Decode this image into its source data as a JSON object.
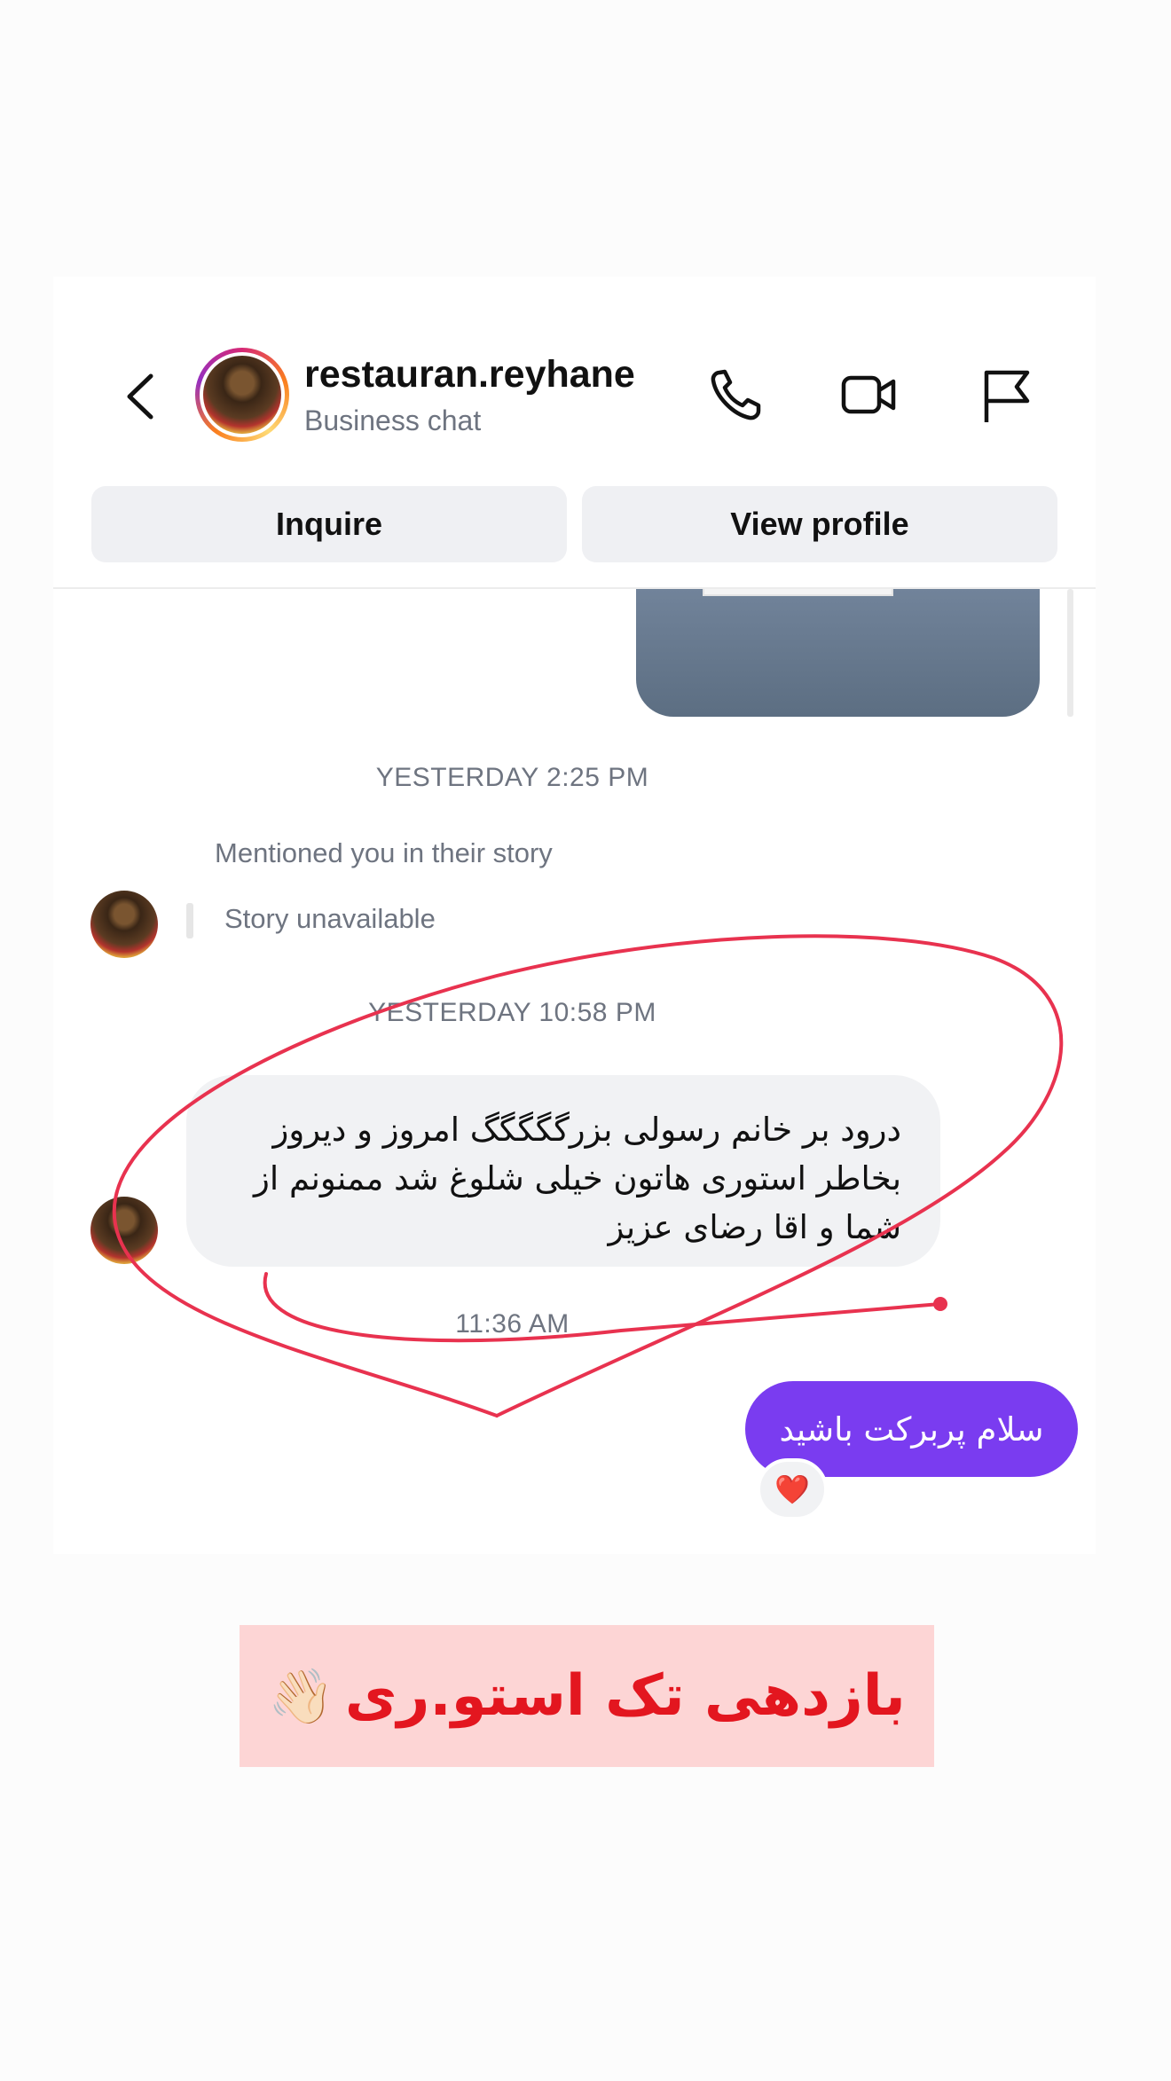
{
  "header": {
    "username": "restauran.reyhane",
    "subtitle": "Business chat",
    "icons": [
      "back-arrow-icon",
      "phone-icon",
      "video-camera-icon",
      "flag-icon"
    ]
  },
  "actions": {
    "inquire_label": "Inquire",
    "view_profile_label": "View profile"
  },
  "messages": {
    "timestamp_1": "YESTERDAY 2:25 PM",
    "mention_label": "Mentioned you in their story",
    "story_status": "Story unavailable",
    "timestamp_2": "YESTERDAY 10:58 PM",
    "incoming_text": "درود بر خانم رسولی بزرگگگگگ امروز و دیروز بخاطر استوری هاتون خیلی شلوغ شد ممنونم از شما و اقا رضای عزیز",
    "timestamp_3": "11:36 AM",
    "outgoing_text": "سلام پربرکت باشید",
    "reaction": "❤️"
  },
  "caption": {
    "text": "بازدهی تک استو.ری",
    "emoji": "👋🏻"
  },
  "colors": {
    "outgoing_bubble": "#7a3cf0",
    "incoming_bubble": "#f1f2f4",
    "annotation_stroke": "#e8324f",
    "caption_bg": "#fdd5d5",
    "caption_text": "#e3161f"
  }
}
